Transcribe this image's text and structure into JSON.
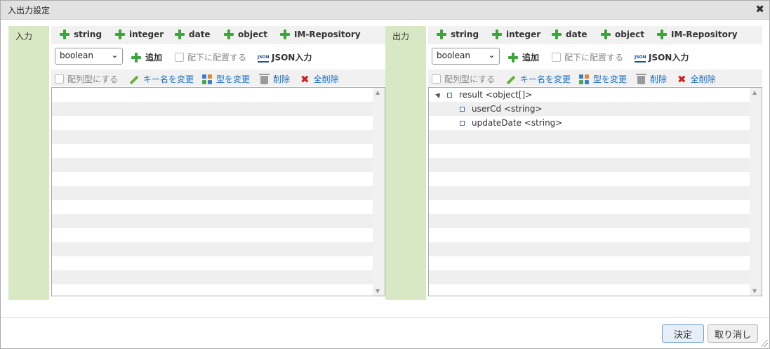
{
  "dialog": {
    "title": "入出力設定",
    "close_icon": "✖"
  },
  "panels": [
    {
      "label": "入力",
      "add_types": [
        "string",
        "integer",
        "date",
        "object",
        "IM-Repository"
      ],
      "type_select": "boolean",
      "add_label": "追加",
      "place_below_label": "配下に配置する",
      "json_input_label": "JSON入力",
      "array_label": "配列型にする",
      "rename_key_label": "キー名を変更",
      "change_type_label": "型を変更",
      "delete_label": "削除",
      "delete_all_label": "全削除",
      "tree": []
    },
    {
      "label": "出力",
      "add_types": [
        "string",
        "integer",
        "date",
        "object",
        "IM-Repository"
      ],
      "type_select": "boolean",
      "add_label": "追加",
      "place_below_label": "配下に配置する",
      "json_input_label": "JSON入力",
      "array_label": "配列型にする",
      "rename_key_label": "キー名を変更",
      "change_type_label": "型を変更",
      "delete_label": "削除",
      "delete_all_label": "全削除",
      "tree": [
        {
          "name": "result",
          "type": "<object[]>",
          "level": 0,
          "expanded": true
        },
        {
          "name": "userCd",
          "type": "<string>",
          "level": 1
        },
        {
          "name": "updateDate",
          "type": "<string>",
          "level": 1
        }
      ]
    }
  ],
  "footer": {
    "ok_label": "決定",
    "cancel_label": "取り消し"
  },
  "icons": {
    "add": "plus-icon",
    "json": "json-icon",
    "rename": "pencil-icon",
    "change_type": "swap-icon",
    "delete": "trash-icon",
    "delete_all": "x-icon"
  },
  "colors": {
    "side_label_bg": "#d9e8c4",
    "plus_green": "#3aa63a",
    "link_blue": "#1c6fc0",
    "delete_all_red": "#d0241b"
  }
}
